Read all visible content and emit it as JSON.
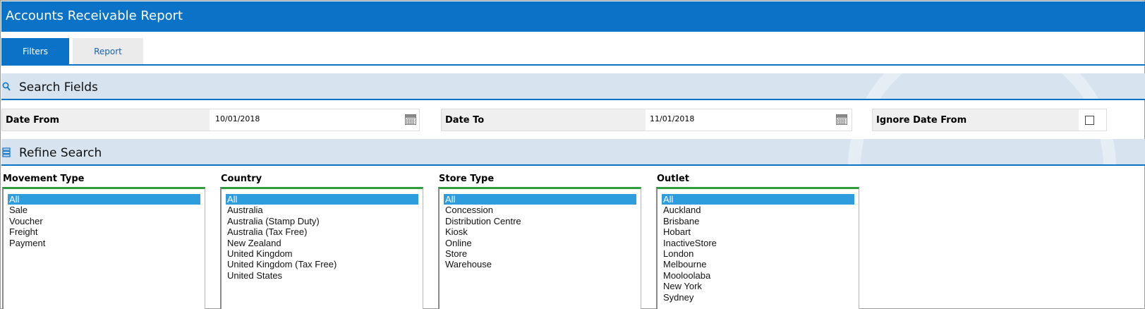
{
  "window": {
    "title": "Accounts Receivable Report"
  },
  "tabs": [
    {
      "label": "Filters",
      "active": true
    },
    {
      "label": "Report",
      "active": false
    }
  ],
  "sections": {
    "search": {
      "label": "Search Fields",
      "icon": "search-icon"
    },
    "refine": {
      "label": "Refine Search",
      "icon": "list-icon"
    }
  },
  "fields": {
    "date_from": {
      "label": "Date From",
      "value": "10/01/2018",
      "icon": "calendar-icon"
    },
    "date_to": {
      "label": "Date To",
      "value": "11/01/2018",
      "icon": "calendar-icon"
    },
    "ignore_date_from": {
      "label": "Ignore Date From",
      "checked": false
    }
  },
  "lists": [
    {
      "title": "Movement Type",
      "selected": "All",
      "options": [
        "All",
        "Sale",
        "Voucher",
        "Freight",
        "Payment"
      ]
    },
    {
      "title": "Country",
      "selected": "All",
      "options": [
        "All",
        "Australia",
        "Australia (Stamp Duty)",
        "Australia (Tax Free)",
        "New Zealand",
        "United Kingdom",
        "United Kingdom (Tax Free)",
        "United States"
      ]
    },
    {
      "title": "Store Type",
      "selected": "All",
      "options": [
        "All",
        "Concession",
        "Distribution Centre",
        "Kiosk",
        "Online",
        "Store",
        "Warehouse"
      ]
    },
    {
      "title": "Outlet",
      "selected": "All",
      "options": [
        "All",
        "Auckland",
        "Brisbane",
        "Hobart",
        "InactiveStore",
        "London",
        "Melbourne",
        "Mooloolaba",
        "New York",
        "Sydney"
      ]
    }
  ],
  "colors": {
    "accent": "#0a72c7",
    "selection": "#2e9ddd",
    "list_top_border": "#2f9b3c",
    "section_bg": "#d8e3f0"
  }
}
